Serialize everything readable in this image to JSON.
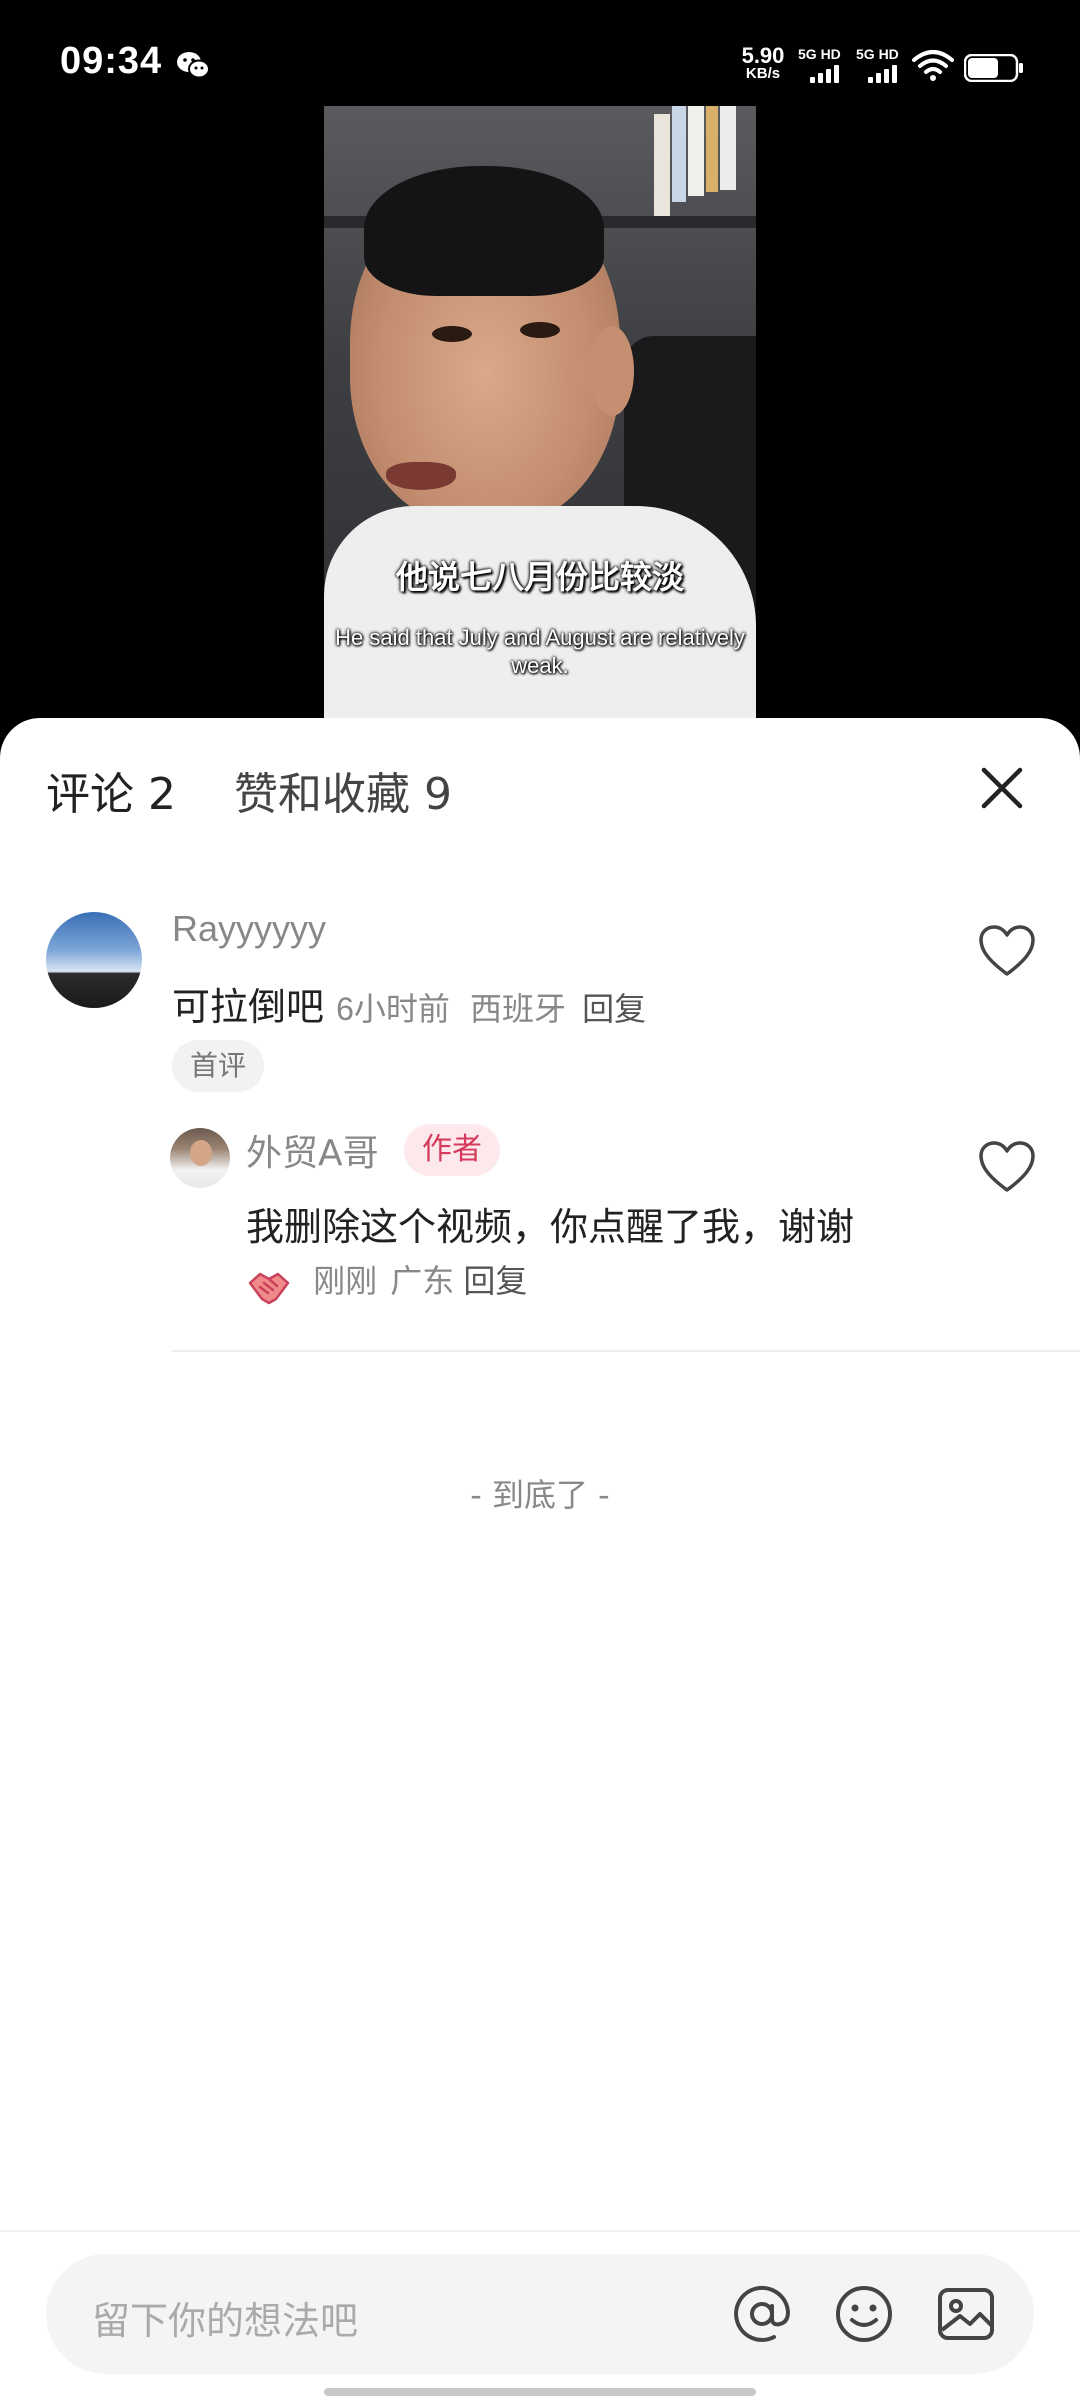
{
  "status_bar": {
    "time": "09:34",
    "net_speed_value": "5.90",
    "net_speed_unit": "KB/s",
    "sim1_label": "5G HD",
    "sim2_label": "5G HD",
    "icons": [
      "wechat-icon",
      "signal-icon",
      "wifi-icon",
      "battery-icon"
    ]
  },
  "video": {
    "subtitle_cn": "他说七八月份比较淡",
    "subtitle_en": "He said that July and August are relatively weak."
  },
  "sheet": {
    "tab_comments": "评论 2",
    "tab_likes": "赞和收藏 9",
    "close_icon": "close-icon",
    "comments": [
      {
        "username": "Rayyyyyy",
        "text": "可拉倒吧",
        "time": "6小时前",
        "location": "西班牙",
        "reply_label": "回复",
        "tag": "首评",
        "liked": false
      }
    ],
    "replies": [
      {
        "username": "外贸A哥",
        "badge": "作者",
        "text": "我删除这个视频，你点醒了我，谢谢",
        "emoji": "handshake-icon",
        "time": "刚刚",
        "location": "广东",
        "reply_label": "回复",
        "liked": false
      }
    ],
    "end_text": "- 到底了 -"
  },
  "input": {
    "placeholder": "留下你的想法吧",
    "icons": [
      "at-icon",
      "emoji-icon",
      "image-icon"
    ]
  },
  "colors": {
    "accent_badge_text": "#d63a5a",
    "accent_badge_bg": "#fde8ec"
  }
}
